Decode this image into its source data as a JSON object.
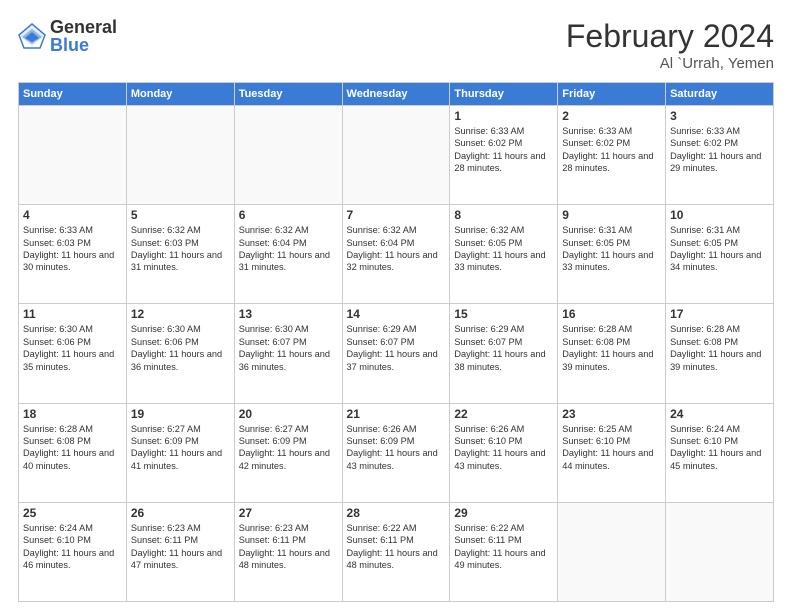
{
  "logo": {
    "general": "General",
    "blue": "Blue"
  },
  "header": {
    "month": "February 2024",
    "location": "Al `Urrah, Yemen"
  },
  "weekdays": [
    "Sunday",
    "Monday",
    "Tuesday",
    "Wednesday",
    "Thursday",
    "Friday",
    "Saturday"
  ],
  "weeks": [
    [
      {
        "day": "",
        "info": ""
      },
      {
        "day": "",
        "info": ""
      },
      {
        "day": "",
        "info": ""
      },
      {
        "day": "",
        "info": ""
      },
      {
        "day": "1",
        "info": "Sunrise: 6:33 AM\nSunset: 6:02 PM\nDaylight: 11 hours and 28 minutes."
      },
      {
        "day": "2",
        "info": "Sunrise: 6:33 AM\nSunset: 6:02 PM\nDaylight: 11 hours and 28 minutes."
      },
      {
        "day": "3",
        "info": "Sunrise: 6:33 AM\nSunset: 6:02 PM\nDaylight: 11 hours and 29 minutes."
      }
    ],
    [
      {
        "day": "4",
        "info": "Sunrise: 6:33 AM\nSunset: 6:03 PM\nDaylight: 11 hours and 30 minutes."
      },
      {
        "day": "5",
        "info": "Sunrise: 6:32 AM\nSunset: 6:03 PM\nDaylight: 11 hours and 31 minutes."
      },
      {
        "day": "6",
        "info": "Sunrise: 6:32 AM\nSunset: 6:04 PM\nDaylight: 11 hours and 31 minutes."
      },
      {
        "day": "7",
        "info": "Sunrise: 6:32 AM\nSunset: 6:04 PM\nDaylight: 11 hours and 32 minutes."
      },
      {
        "day": "8",
        "info": "Sunrise: 6:32 AM\nSunset: 6:05 PM\nDaylight: 11 hours and 33 minutes."
      },
      {
        "day": "9",
        "info": "Sunrise: 6:31 AM\nSunset: 6:05 PM\nDaylight: 11 hours and 33 minutes."
      },
      {
        "day": "10",
        "info": "Sunrise: 6:31 AM\nSunset: 6:05 PM\nDaylight: 11 hours and 34 minutes."
      }
    ],
    [
      {
        "day": "11",
        "info": "Sunrise: 6:30 AM\nSunset: 6:06 PM\nDaylight: 11 hours and 35 minutes."
      },
      {
        "day": "12",
        "info": "Sunrise: 6:30 AM\nSunset: 6:06 PM\nDaylight: 11 hours and 36 minutes."
      },
      {
        "day": "13",
        "info": "Sunrise: 6:30 AM\nSunset: 6:07 PM\nDaylight: 11 hours and 36 minutes."
      },
      {
        "day": "14",
        "info": "Sunrise: 6:29 AM\nSunset: 6:07 PM\nDaylight: 11 hours and 37 minutes."
      },
      {
        "day": "15",
        "info": "Sunrise: 6:29 AM\nSunset: 6:07 PM\nDaylight: 11 hours and 38 minutes."
      },
      {
        "day": "16",
        "info": "Sunrise: 6:28 AM\nSunset: 6:08 PM\nDaylight: 11 hours and 39 minutes."
      },
      {
        "day": "17",
        "info": "Sunrise: 6:28 AM\nSunset: 6:08 PM\nDaylight: 11 hours and 39 minutes."
      }
    ],
    [
      {
        "day": "18",
        "info": "Sunrise: 6:28 AM\nSunset: 6:08 PM\nDaylight: 11 hours and 40 minutes."
      },
      {
        "day": "19",
        "info": "Sunrise: 6:27 AM\nSunset: 6:09 PM\nDaylight: 11 hours and 41 minutes."
      },
      {
        "day": "20",
        "info": "Sunrise: 6:27 AM\nSunset: 6:09 PM\nDaylight: 11 hours and 42 minutes."
      },
      {
        "day": "21",
        "info": "Sunrise: 6:26 AM\nSunset: 6:09 PM\nDaylight: 11 hours and 43 minutes."
      },
      {
        "day": "22",
        "info": "Sunrise: 6:26 AM\nSunset: 6:10 PM\nDaylight: 11 hours and 43 minutes."
      },
      {
        "day": "23",
        "info": "Sunrise: 6:25 AM\nSunset: 6:10 PM\nDaylight: 11 hours and 44 minutes."
      },
      {
        "day": "24",
        "info": "Sunrise: 6:24 AM\nSunset: 6:10 PM\nDaylight: 11 hours and 45 minutes."
      }
    ],
    [
      {
        "day": "25",
        "info": "Sunrise: 6:24 AM\nSunset: 6:10 PM\nDaylight: 11 hours and 46 minutes."
      },
      {
        "day": "26",
        "info": "Sunrise: 6:23 AM\nSunset: 6:11 PM\nDaylight: 11 hours and 47 minutes."
      },
      {
        "day": "27",
        "info": "Sunrise: 6:23 AM\nSunset: 6:11 PM\nDaylight: 11 hours and 48 minutes."
      },
      {
        "day": "28",
        "info": "Sunrise: 6:22 AM\nSunset: 6:11 PM\nDaylight: 11 hours and 48 minutes."
      },
      {
        "day": "29",
        "info": "Sunrise: 6:22 AM\nSunset: 6:11 PM\nDaylight: 11 hours and 49 minutes."
      },
      {
        "day": "",
        "info": ""
      },
      {
        "day": "",
        "info": ""
      }
    ]
  ]
}
